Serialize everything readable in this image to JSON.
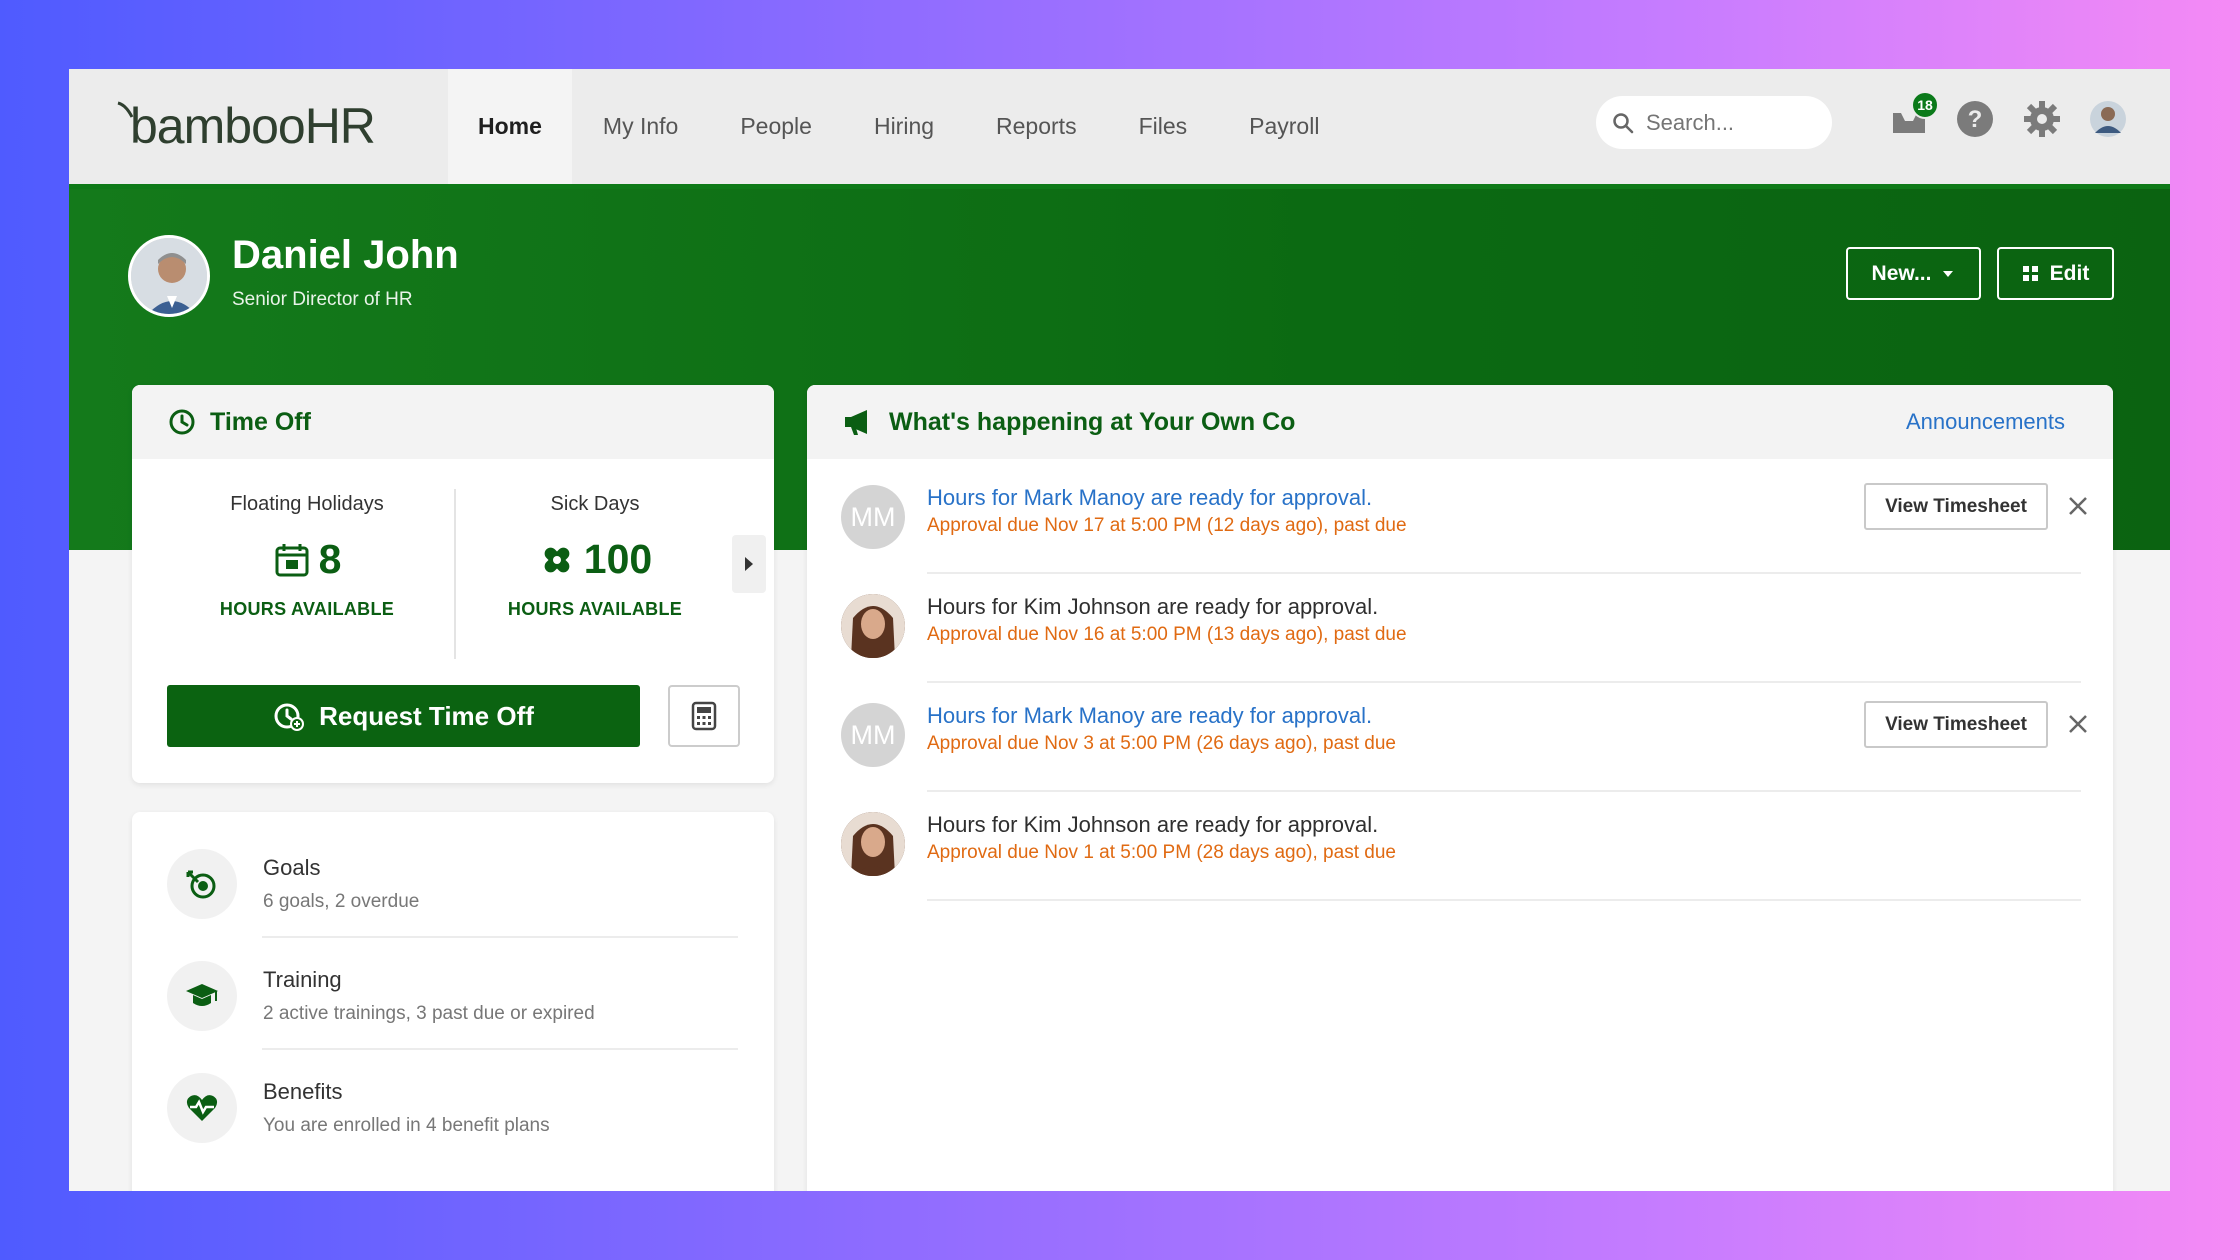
{
  "nav": {
    "logo_text": "bambooHR",
    "tabs": [
      {
        "label": "Home",
        "active": true
      },
      {
        "label": "My Info"
      },
      {
        "label": "People"
      },
      {
        "label": "Hiring"
      },
      {
        "label": "Reports"
      },
      {
        "label": "Files"
      },
      {
        "label": "Payroll"
      }
    ],
    "search_placeholder": "Search...",
    "inbox_badge": "18",
    "icons": [
      "inbox-icon",
      "help-icon",
      "gear-icon",
      "user-avatar"
    ]
  },
  "profile": {
    "name": "Daniel John",
    "title": "Senior Director of HR",
    "new_button": "New...",
    "edit_button": "Edit"
  },
  "time_off": {
    "heading": "Time Off",
    "balances": [
      {
        "label": "Floating Holidays",
        "value": "8",
        "unit": "HOURS AVAILABLE",
        "icon": "calendar-icon"
      },
      {
        "label": "Sick Days",
        "value": "100",
        "unit": "HOURS AVAILABLE",
        "icon": "bandage-icon"
      }
    ],
    "request_button": "Request Time Off"
  },
  "quick_links": [
    {
      "title": "Goals",
      "subtitle": "6 goals, 2 overdue",
      "icon": "goals-icon"
    },
    {
      "title": "Training",
      "subtitle": "2 active trainings, 3 past due or expired",
      "icon": "graduation-cap-icon"
    },
    {
      "title": "Benefits",
      "subtitle": "You are enrolled in 4 benefit plans",
      "icon": "heart-icon"
    }
  ],
  "feed": {
    "heading": "What's happening at Your Own Co",
    "announcements_link": "Announcements",
    "items": [
      {
        "initials": "MM",
        "title": "Hours for Mark Manoy are ready for approval.",
        "subtitle": "Approval due Nov 17 at 5:00 PM (12 days ago), past due",
        "link": true,
        "button": "View Timesheet"
      },
      {
        "initials": "",
        "title": "Hours for Kim Johnson are ready for approval.",
        "subtitle": "Approval due Nov 16 at 5:00 PM (13 days ago), past due",
        "link": false,
        "button": ""
      },
      {
        "initials": "MM",
        "title": "Hours for Mark Manoy are ready for approval.",
        "subtitle": "Approval due Nov 3 at 5:00 PM (26 days ago), past due",
        "link": true,
        "button": "View Timesheet"
      },
      {
        "initials": "",
        "title": "Hours for Kim Johnson are ready for approval.",
        "subtitle": "Approval due Nov 1 at 5:00 PM (28 days ago), past due",
        "link": false,
        "button": ""
      }
    ]
  },
  "colors": {
    "brand_green": "#0b6311",
    "link_blue": "#2872c8",
    "past_due_orange": "#e06a12"
  }
}
